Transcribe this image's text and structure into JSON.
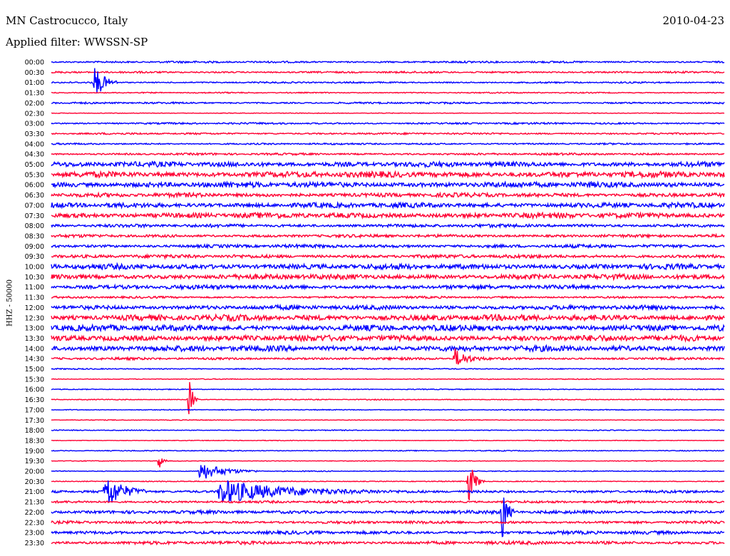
{
  "header": {
    "station": "MN Castrocucco, Italy",
    "filter": "Applied filter: WWSSN-SP",
    "date": "2010-04-23"
  },
  "chart_data": {
    "type": "line",
    "title": "MN Castrocucco, Italy",
    "subtitle": "Applied filter: WWSSN-SP",
    "date": "2010-04-23",
    "ylabel": "HHZ - 50000",
    "colors": [
      "#0000ff",
      "#ff0033"
    ],
    "rows": [
      {
        "label": "00:00",
        "color": "#0000ff",
        "level": 0.32,
        "events": []
      },
      {
        "label": "00:30",
        "color": "#ff0033",
        "level": 0.3,
        "events": []
      },
      {
        "label": "01:00",
        "color": "#0000ff",
        "level": 0.26,
        "events": [
          {
            "t": 0.065,
            "amp": 1.8,
            "dur": 0.012
          }
        ]
      },
      {
        "label": "01:30",
        "color": "#ff0033",
        "level": 0.2,
        "events": []
      },
      {
        "label": "02:00",
        "color": "#0000ff",
        "level": 0.3,
        "events": []
      },
      {
        "label": "02:30",
        "color": "#ff0033",
        "level": 0.12,
        "events": []
      },
      {
        "label": "03:00",
        "color": "#0000ff",
        "level": 0.3,
        "events": []
      },
      {
        "label": "03:30",
        "color": "#ff0033",
        "level": 0.3,
        "events": []
      },
      {
        "label": "04:00",
        "color": "#0000ff",
        "level": 0.28,
        "events": []
      },
      {
        "label": "04:30",
        "color": "#ff0033",
        "level": 0.35,
        "events": []
      },
      {
        "label": "05:00",
        "color": "#0000ff",
        "level": 0.85,
        "events": []
      },
      {
        "label": "05:30",
        "color": "#ff0033",
        "level": 1.0,
        "events": []
      },
      {
        "label": "06:00",
        "color": "#0000ff",
        "level": 0.95,
        "events": []
      },
      {
        "label": "06:30",
        "color": "#ff0033",
        "level": 0.7,
        "events": []
      },
      {
        "label": "07:00",
        "color": "#0000ff",
        "level": 0.85,
        "events": []
      },
      {
        "label": "07:30",
        "color": "#ff0033",
        "level": 0.9,
        "events": []
      },
      {
        "label": "08:00",
        "color": "#0000ff",
        "level": 0.55,
        "events": []
      },
      {
        "label": "08:30",
        "color": "#ff0033",
        "level": 0.5,
        "events": []
      },
      {
        "label": "09:00",
        "color": "#0000ff",
        "level": 0.55,
        "events": []
      },
      {
        "label": "09:30",
        "color": "#ff0033",
        "level": 0.6,
        "events": []
      },
      {
        "label": "10:00",
        "color": "#0000ff",
        "level": 0.9,
        "events": []
      },
      {
        "label": "10:30",
        "color": "#ff0033",
        "level": 0.85,
        "events": []
      },
      {
        "label": "11:00",
        "color": "#0000ff",
        "level": 0.7,
        "events": []
      },
      {
        "label": "11:30",
        "color": "#ff0033",
        "level": 0.35,
        "events": []
      },
      {
        "label": "12:00",
        "color": "#0000ff",
        "level": 0.75,
        "events": []
      },
      {
        "label": "12:30",
        "color": "#ff0033",
        "level": 1.0,
        "events": []
      },
      {
        "label": "13:00",
        "color": "#0000ff",
        "level": 1.0,
        "events": []
      },
      {
        "label": "13:30",
        "color": "#ff0033",
        "level": 1.0,
        "events": []
      },
      {
        "label": "14:00",
        "color": "#0000ff",
        "level": 0.95,
        "events": []
      },
      {
        "label": "14:30",
        "color": "#ff0033",
        "level": 0.4,
        "events": [
          {
            "t": 0.6,
            "amp": 1.0,
            "dur": 0.015
          }
        ]
      },
      {
        "label": "15:00",
        "color": "#0000ff",
        "level": 0.2,
        "events": []
      },
      {
        "label": "15:30",
        "color": "#ff0033",
        "level": 0.15,
        "events": []
      },
      {
        "label": "16:00",
        "color": "#0000ff",
        "level": 0.15,
        "events": []
      },
      {
        "label": "16:30",
        "color": "#ff0033",
        "level": 0.15,
        "events": [
          {
            "t": 0.205,
            "amp": 2.2,
            "dur": 0.005
          }
        ]
      },
      {
        "label": "17:00",
        "color": "#0000ff",
        "level": 0.15,
        "events": []
      },
      {
        "label": "17:30",
        "color": "#ff0033",
        "level": 0.12,
        "events": []
      },
      {
        "label": "18:00",
        "color": "#0000ff",
        "level": 0.15,
        "events": []
      },
      {
        "label": "18:30",
        "color": "#ff0033",
        "level": 0.12,
        "events": []
      },
      {
        "label": "19:00",
        "color": "#0000ff",
        "level": 0.15,
        "events": []
      },
      {
        "label": "19:30",
        "color": "#ff0033",
        "level": 0.12,
        "events": [
          {
            "t": 0.16,
            "amp": 1.0,
            "dur": 0.004
          }
        ]
      },
      {
        "label": "20:00",
        "color": "#0000ff",
        "level": 0.15,
        "events": [
          {
            "t": 0.22,
            "amp": 1.0,
            "dur": 0.03
          }
        ]
      },
      {
        "label": "20:30",
        "color": "#ff0033",
        "level": 0.15,
        "events": [
          {
            "t": 0.62,
            "amp": 2.4,
            "dur": 0.008
          }
        ]
      },
      {
        "label": "21:00",
        "color": "#0000ff",
        "level": 0.45,
        "events": [
          {
            "t": 0.08,
            "amp": 2.0,
            "dur": 0.02
          },
          {
            "t": 0.25,
            "amp": 1.3,
            "dur": 0.08
          }
        ]
      },
      {
        "label": "21:30",
        "color": "#ff0033",
        "level": 0.4,
        "events": []
      },
      {
        "label": "22:00",
        "color": "#0000ff",
        "level": 0.55,
        "events": [
          {
            "t": 0.67,
            "amp": 3.0,
            "dur": 0.006
          }
        ]
      },
      {
        "label": "22:30",
        "color": "#ff0033",
        "level": 0.45,
        "events": []
      },
      {
        "label": "23:00",
        "color": "#0000ff",
        "level": 0.55,
        "events": []
      },
      {
        "label": "23:30",
        "color": "#ff0033",
        "level": 0.55,
        "events": []
      }
    ]
  }
}
